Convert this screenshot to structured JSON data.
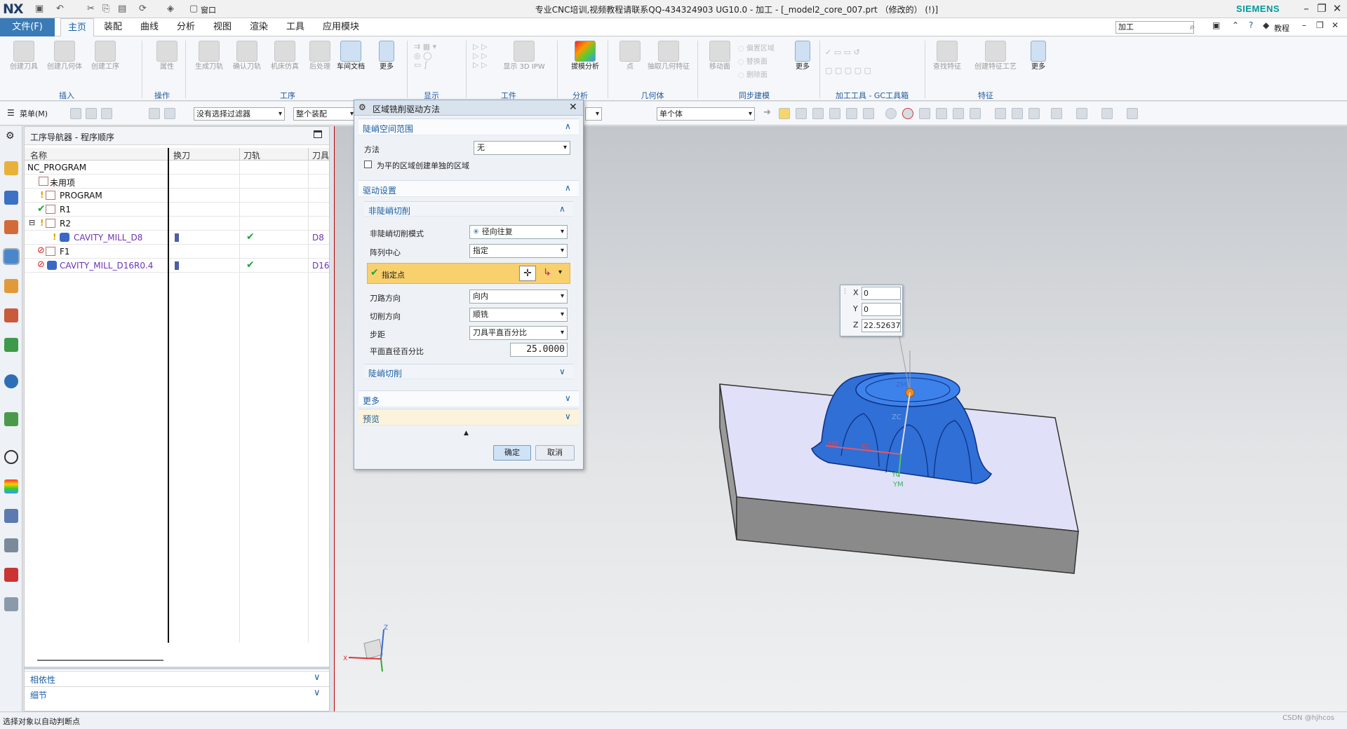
{
  "app": {
    "logo": "NX",
    "quick_window": "窗口",
    "title": "专业CNC培训,视频教程请联系QQ-434324903 UG10.0 - 加工 - [_model2_core_007.prt （修改的）  (!)]",
    "brand": "SIEMENS"
  },
  "menubar": {
    "file": "文件(F)",
    "tabs": [
      "主页",
      "装配",
      "曲线",
      "分析",
      "视图",
      "渲染",
      "工具",
      "应用模块"
    ],
    "search_value": "加工",
    "tutorial": "教程"
  },
  "ribbon": {
    "buttons": [
      "创建刀具",
      "创建几何体",
      "创建工序",
      "属性",
      "生成刀轨",
      "确认刀轨",
      "机床仿真",
      "后处理",
      "车间文档",
      "更多",
      "显示 3D IPW",
      "拔模分析",
      "点",
      "抽取几何特征",
      "移动面",
      "更多",
      "查找特征",
      "创建特征工艺",
      "更多"
    ],
    "small": [
      "偏置区域",
      "替换面",
      "删除面"
    ],
    "groups": [
      "插入",
      "操作",
      "工序",
      "显示",
      "工件",
      "分析",
      "几何体",
      "同步建模",
      "加工工具 - GC工具箱",
      "特征"
    ]
  },
  "toolbar": {
    "menu": "菜单(M)",
    "filter": "没有选择过滤器",
    "assembly": "整个装配",
    "single": "单个体"
  },
  "navigator": {
    "title": "工序导航器 - 程序顺序",
    "columns": [
      "名称",
      "换刀",
      "刀轨",
      "刀具"
    ],
    "rows": [
      {
        "name": "NC_PROGRAM",
        "tool": ""
      },
      {
        "name": "未用项",
        "tool": ""
      },
      {
        "name": "PROGRAM",
        "tool": ""
      },
      {
        "name": "R1",
        "tool": ""
      },
      {
        "name": "R2",
        "tool": ""
      },
      {
        "name": "CAVITY_MILL_D8",
        "tool": "D8"
      },
      {
        "name": "F1",
        "tool": ""
      },
      {
        "name": "CAVITY_MILL_D16R0.4",
        "tool": "D16"
      }
    ],
    "dependencies": "相依性",
    "details": "细节"
  },
  "dialog": {
    "title": "区域铣削驱动方法",
    "sec_steep": "陡峭空间范围",
    "method_label": "方法",
    "method_value": "无",
    "flat_checkbox": "为平的区域创建单独的区域",
    "sec_drive": "驱动设置",
    "sec_nonsteep": "非陡峭切削",
    "mode_label": "非陡峭切削模式",
    "mode_value": "径向往复",
    "center_label": "阵列中心",
    "center_value": "指定",
    "point_label": "指定点",
    "path_dir_label": "刀路方向",
    "path_dir_value": "向内",
    "cut_dir_label": "切削方向",
    "cut_dir_value": "顺铣",
    "step_label": "步距",
    "step_value": "刀具平直百分比",
    "diam_label": "平面直径百分比",
    "diam_value": "25.0000",
    "sec_steep_cut": "陡峭切削",
    "sec_more": "更多",
    "sec_preview": "预览",
    "ok": "确定",
    "cancel": "取消"
  },
  "coords": {
    "x": "0",
    "y": "0",
    "z": "22.52637"
  },
  "axes": {
    "zm": "ZM",
    "zc": "ZC",
    "xm": "XM",
    "xc": "XC",
    "yc": "YC",
    "ym": "YM",
    "tx": "X",
    "tz": "Z"
  },
  "status": "选择对象以自动判断点",
  "watermark": "CSDN @hjhcos",
  "colors": {
    "accent": "#1d5fa3",
    "file_tab": "#3a7bb7",
    "part_blue": "#2f6fd6",
    "block_top": "#e0e0f8"
  }
}
